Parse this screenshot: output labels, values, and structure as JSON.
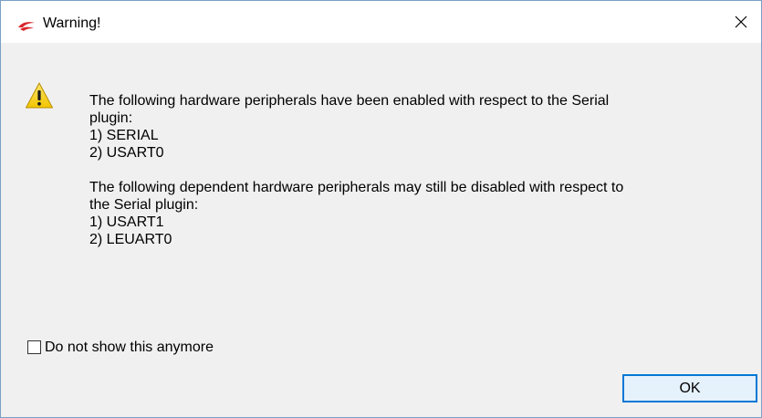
{
  "window": {
    "title": "Warning!",
    "close_icon": "close-icon",
    "app_icon": "silabs-logo-icon"
  },
  "message": {
    "icon": "warning-icon",
    "section1": {
      "intro_line1": "The following hardware peripherals have been enabled with respect to the Serial",
      "intro_line2": "plugin:",
      "items": [
        "1) SERIAL",
        "2) USART0"
      ]
    },
    "section2": {
      "intro_line1": "The following dependent hardware peripherals may still be disabled with respect to",
      "intro_line2": "the Serial plugin:",
      "items": [
        "1) USART1",
        "2) LEUART0"
      ]
    }
  },
  "checkbox": {
    "label": "Do not show this anymore",
    "checked": false
  },
  "buttons": {
    "ok_label": "OK"
  },
  "colors": {
    "accent": "#0078d7",
    "logo_red": "#d9262b",
    "warning_yellow": "#f7d21a"
  }
}
